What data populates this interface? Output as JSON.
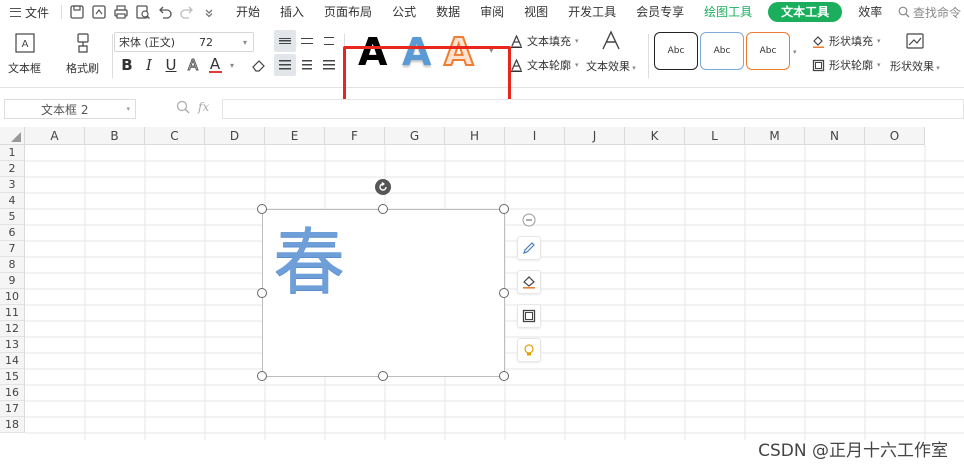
{
  "menu": {
    "file": "文件",
    "quick_icons": [
      "save-icon",
      "save-as-pdf-icon",
      "print-icon",
      "print-preview-icon",
      "undo-icon",
      "redo-icon",
      "more-chevron-icon"
    ],
    "tabs": [
      {
        "label": "开始",
        "style": "normal"
      },
      {
        "label": "插入",
        "style": "normal"
      },
      {
        "label": "页面布局",
        "style": "normal"
      },
      {
        "label": "公式",
        "style": "normal"
      },
      {
        "label": "数据",
        "style": "normal"
      },
      {
        "label": "审阅",
        "style": "normal"
      },
      {
        "label": "视图",
        "style": "normal"
      },
      {
        "label": "开发工具",
        "style": "normal"
      },
      {
        "label": "会员专享",
        "style": "normal"
      },
      {
        "label": "绘图工具",
        "style": "green"
      },
      {
        "label": "文本工具",
        "style": "active"
      },
      {
        "label": "效率",
        "style": "normal"
      }
    ],
    "search": "查找命令"
  },
  "ribbon": {
    "textbox_label": "文本框",
    "format_painter_label": "格式刷",
    "font_name": "宋体 (正文)",
    "font_size": "72",
    "bold": "B",
    "italic": "I",
    "underline": "U",
    "outline_a": "A",
    "font_color_a": "A",
    "preset_letter": "A",
    "text_fill": "文本填充",
    "text_outline": "文本轮廓",
    "text_effect": "文本效果",
    "shape_style_sample": "Abc",
    "shape_fill": "形状填充",
    "shape_outline": "形状轮廓",
    "shape_effect": "形状效果",
    "colors": {
      "accent": "#1aae5d",
      "red_box": "#e8261b",
      "blue_a": "#5b9bd5",
      "orange_a": "#ed7d31",
      "font_color_bar": "#e03a3a"
    }
  },
  "formula_bar": {
    "name_box": "文本框 2",
    "fx": "fx"
  },
  "sheet": {
    "columns": [
      "A",
      "B",
      "C",
      "D",
      "E",
      "F",
      "G",
      "H",
      "I",
      "J",
      "K",
      "L",
      "M",
      "N",
      "O"
    ],
    "rows": [
      "1",
      "2",
      "3",
      "4",
      "5",
      "6",
      "7",
      "8",
      "9",
      "10",
      "11",
      "12",
      "13",
      "14",
      "15",
      "16",
      "17",
      "18"
    ],
    "textbox_content": "春"
  },
  "watermark": "CSDN @正月十六工作室"
}
